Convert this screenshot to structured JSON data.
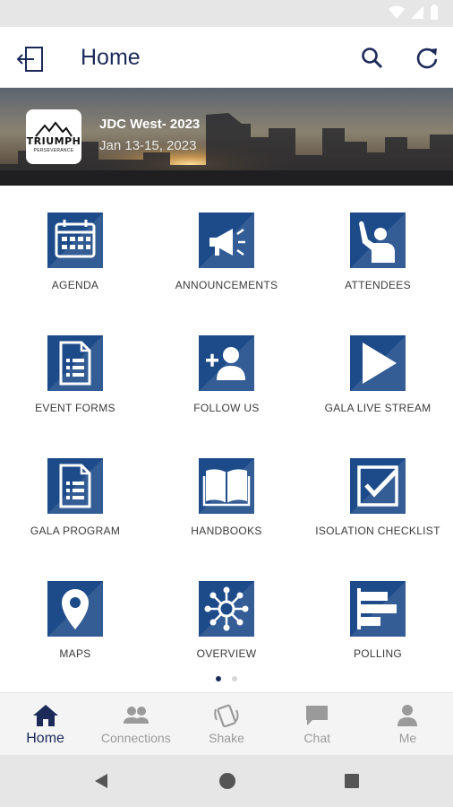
{
  "header": {
    "title": "Home"
  },
  "banner": {
    "logo_text": "TRIUMPH",
    "logo_subtext": "PERSEVERANCE",
    "event_name": "JDC West- 2023",
    "event_dates": "Jan 13-15, 2023"
  },
  "tiles": [
    {
      "label": "AGENDA",
      "icon": "calendar-icon"
    },
    {
      "label": "ANNOUNCEMENTS",
      "icon": "megaphone-icon"
    },
    {
      "label": "ATTENDEES",
      "icon": "person-raising-hand-icon"
    },
    {
      "label": "EVENT FORMS",
      "icon": "form-document-icon"
    },
    {
      "label": "FOLLOW US",
      "icon": "add-person-icon"
    },
    {
      "label": "GALA LIVE STREAM",
      "icon": "play-icon"
    },
    {
      "label": "GALA PROGRAM",
      "icon": "program-document-icon"
    },
    {
      "label": "HANDBOOKS",
      "icon": "open-book-icon"
    },
    {
      "label": "ISOLATION CHECKLIST",
      "icon": "checkbox-icon"
    },
    {
      "label": "MAPS",
      "icon": "map-pin-icon"
    },
    {
      "label": "OVERVIEW",
      "icon": "network-hub-icon"
    },
    {
      "label": "POLLING",
      "icon": "poll-bars-icon"
    }
  ],
  "pager": {
    "pages": 2,
    "current": 1
  },
  "bottom_nav": [
    {
      "label": "Home",
      "icon": "home-icon",
      "active": true
    },
    {
      "label": "Connections",
      "icon": "people-icon",
      "active": false
    },
    {
      "label": "Shake",
      "icon": "shake-phone-icon",
      "active": false
    },
    {
      "label": "Chat",
      "icon": "chat-bubble-icon",
      "active": false
    },
    {
      "label": "Me",
      "icon": "person-icon",
      "active": false
    }
  ],
  "colors": {
    "accent": "#1d4b8a",
    "title": "#1c2a5a",
    "nav_inactive": "#9a9a9a"
  }
}
